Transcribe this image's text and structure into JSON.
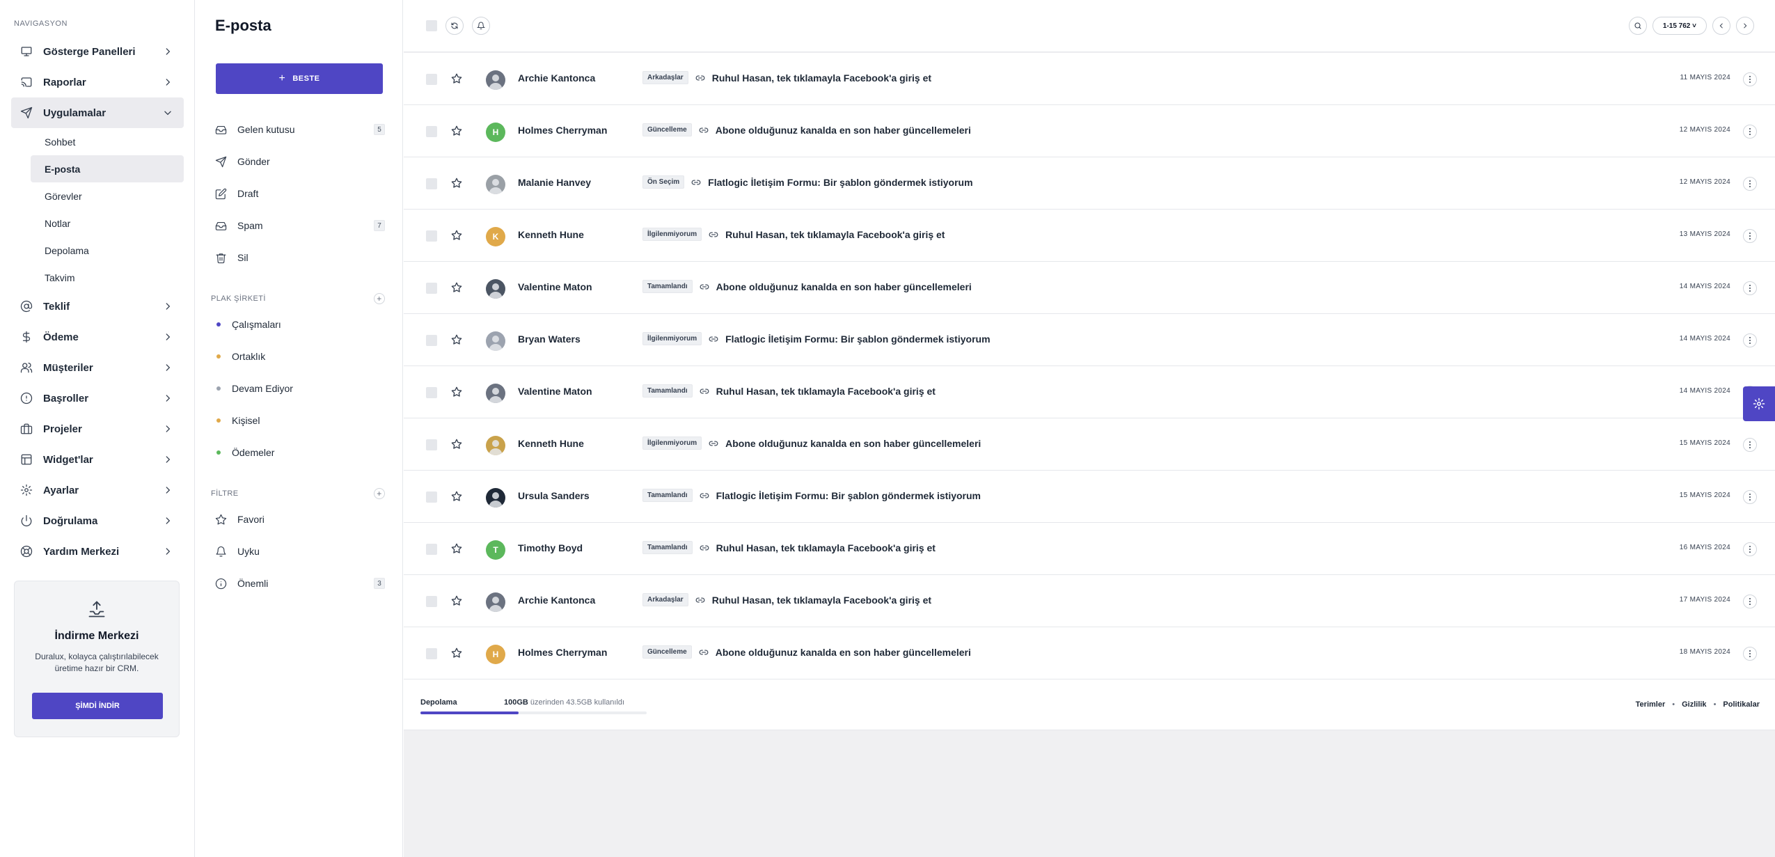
{
  "nav": {
    "heading": "NAVIGASYON",
    "items": [
      {
        "label": "Gösterge Panelleri",
        "icon": "monitor-icon"
      },
      {
        "label": "Raporlar",
        "icon": "cast-icon"
      },
      {
        "label": "Uygulamalar",
        "icon": "send-icon",
        "open": true
      },
      {
        "label": "Teklif",
        "icon": "at-icon"
      },
      {
        "label": "Ödeme",
        "icon": "dollar-icon"
      },
      {
        "label": "Müşteriler",
        "icon": "users-icon"
      },
      {
        "label": "Başroller",
        "icon": "alert-circle-icon"
      },
      {
        "label": "Projeler",
        "icon": "briefcase-icon"
      },
      {
        "label": "Widget'lar",
        "icon": "layout-icon"
      },
      {
        "label": "Ayarlar",
        "icon": "settings-icon"
      },
      {
        "label": "Doğrulama",
        "icon": "power-icon"
      },
      {
        "label": "Yardım Merkezi",
        "icon": "lifebuoy-icon"
      }
    ],
    "sub_items": [
      "Sohbet",
      "E-posta",
      "Görevler",
      "Notlar",
      "Depolama",
      "Takvim"
    ],
    "active_sub": "E-posta"
  },
  "download_card": {
    "title": "İndirme Merkezi",
    "description": "Duralux, kolayca çalıştırılabilecek üretime hazır bir CRM.",
    "button": "ŞİMDİ İNDİR"
  },
  "mail": {
    "title": "E-posta",
    "compose": "BESTE",
    "folders": [
      {
        "label": "Gelen kutusu",
        "icon": "inbox-icon",
        "count": "5"
      },
      {
        "label": "Gönder",
        "icon": "send-icon",
        "count": ""
      },
      {
        "label": "Draft",
        "icon": "edit-icon",
        "count": ""
      },
      {
        "label": "Spam",
        "icon": "inbox-icon",
        "count": "7"
      },
      {
        "label": "Sil",
        "icon": "trash-icon",
        "count": ""
      }
    ],
    "labels_heading": "PLAK ŞİRKETİ",
    "labels": [
      {
        "label": "Çalışmaları",
        "color": "#4f46c4"
      },
      {
        "label": "Ortaklık",
        "color": "#e0a94a"
      },
      {
        "label": "Devam Ediyor",
        "color": "#9ca3af"
      },
      {
        "label": "Kişisel",
        "color": "#e0a94a"
      },
      {
        "label": "Ödemeler",
        "color": "#5cb85c"
      }
    ],
    "filters_heading": "FİLTRE",
    "filters": [
      {
        "label": "Favori",
        "icon": "star-icon",
        "count": ""
      },
      {
        "label": "Uyku",
        "icon": "bell-icon",
        "count": ""
      },
      {
        "label": "Önemli",
        "icon": "info-icon",
        "count": "3"
      }
    ]
  },
  "toolbar": {
    "pager": "1-15 762 ˅"
  },
  "emails": [
    {
      "name": "Archie Kantonca",
      "tag": "Arkadaşlar",
      "subject": "Ruhul Hasan, tek tıklamayla Facebook'a giriş et",
      "date": "11 MAYIS 2024",
      "avatar": "photo",
      "initial": "",
      "color": "#6b7280"
    },
    {
      "name": "Holmes Cherryman",
      "tag": "Güncelleme",
      "subject": "Abone olduğunuz kanalda en son haber güncellemeleri",
      "date": "12 MAYIS 2024",
      "avatar": "initial",
      "initial": "H",
      "color": "#5cb85c"
    },
    {
      "name": "Malanie Hanvey",
      "tag": "Ön Seçim",
      "subject": "Flatlogic İletişim Formu: Bir şablon göndermek istiyorum",
      "date": "12 MAYIS 2024",
      "avatar": "photo",
      "initial": "",
      "color": "#9aa0a6"
    },
    {
      "name": "Kenneth Hune",
      "tag": "İlgilenmiyorum",
      "subject": "Ruhul Hasan, tek tıklamayla Facebook'a giriş et",
      "date": "13 MAYIS 2024",
      "avatar": "initial",
      "initial": "K",
      "color": "#e0a94a"
    },
    {
      "name": "Valentine Maton",
      "tag": "Tamamlandı",
      "subject": "Abone olduğunuz kanalda en son haber güncellemeleri",
      "date": "14 MAYIS 2024",
      "avatar": "photo",
      "initial": "",
      "color": "#4b5563"
    },
    {
      "name": "Bryan Waters",
      "tag": "İlgilenmiyorum",
      "subject": "Flatlogic İletişim Formu: Bir şablon göndermek istiyorum",
      "date": "14 MAYIS 2024",
      "avatar": "photo",
      "initial": "",
      "color": "#9ca3af"
    },
    {
      "name": "Valentine Maton",
      "tag": "Tamamlandı",
      "subject": "Ruhul Hasan, tek tıklamayla Facebook'a giriş et",
      "date": "14 MAYIS 2024",
      "avatar": "photo",
      "initial": "",
      "color": "#6b7280"
    },
    {
      "name": "Kenneth Hune",
      "tag": "İlgilenmiyorum",
      "subject": "Abone olduğunuz kanalda en son haber güncellemeleri",
      "date": "15 MAYIS 2024",
      "avatar": "photo",
      "initial": "",
      "color": "#c9a24b"
    },
    {
      "name": "Ursula Sanders",
      "tag": "Tamamlandı",
      "subject": "Flatlogic İletişim Formu: Bir şablon göndermek istiyorum",
      "date": "15 MAYIS 2024",
      "avatar": "photo",
      "initial": "",
      "color": "#1f2937"
    },
    {
      "name": "Timothy Boyd",
      "tag": "Tamamlandı",
      "subject": "Ruhul Hasan, tek tıklamayla Facebook'a giriş et",
      "date": "16 MAYIS 2024",
      "avatar": "initial",
      "initial": "T",
      "color": "#5cb85c"
    },
    {
      "name": "Archie Kantonca",
      "tag": "Arkadaşlar",
      "subject": "Ruhul Hasan, tek tıklamayla Facebook'a giriş et",
      "date": "17 MAYIS 2024",
      "avatar": "photo",
      "initial": "",
      "color": "#6b7280"
    },
    {
      "name": "Holmes Cherryman",
      "tag": "Güncelleme",
      "subject": "Abone olduğunuz kanalda en son haber güncellemeleri",
      "date": "18 MAYIS 2024",
      "avatar": "initial",
      "initial": "H",
      "color": "#e0a94a"
    }
  ],
  "footer": {
    "storage_label": "Depolama",
    "storage_total": "100GB",
    "storage_text": " üzerinden 43.5GB kullanıldı",
    "storage_fraction": 0.435,
    "links": [
      "Terimler",
      "Gizlilik",
      "Politikalar"
    ]
  },
  "colors": {
    "accent": "#4f46c4"
  }
}
